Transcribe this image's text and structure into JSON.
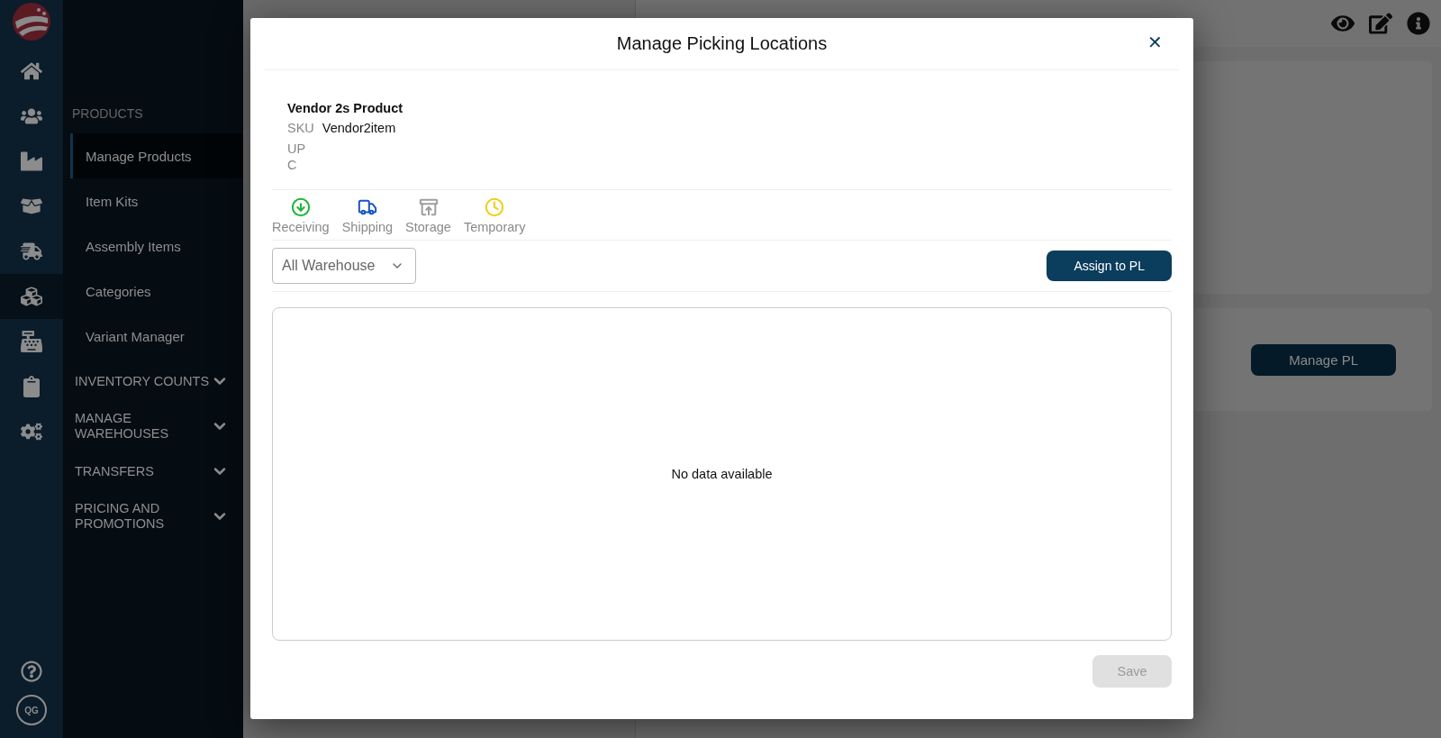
{
  "rail": {
    "items": [
      {
        "kind": "home",
        "selected": false
      },
      {
        "kind": "users",
        "selected": false
      },
      {
        "kind": "factory",
        "selected": false
      },
      {
        "kind": "box",
        "selected": false
      },
      {
        "kind": "truck",
        "selected": false
      },
      {
        "kind": "boxes",
        "selected": true
      },
      {
        "kind": "register",
        "selected": false
      },
      {
        "kind": "clipboard",
        "selected": false
      },
      {
        "kind": "gears",
        "selected": false
      }
    ],
    "avatar": "QG"
  },
  "sidebar": {
    "section": "PRODUCTS",
    "items": [
      {
        "label": "Manage Products",
        "selected": true
      },
      {
        "label": "Item Kits",
        "selected": false
      },
      {
        "label": "Assembly Items",
        "selected": false
      },
      {
        "label": "Categories",
        "selected": false
      },
      {
        "label": "Variant Manager",
        "selected": false
      }
    ],
    "groups": [
      {
        "label": "INVENTORY COUNTS",
        "expanded": false
      },
      {
        "label": "MANAGE WAREHOUSES",
        "expanded": false
      },
      {
        "label": "TRANSFERS",
        "expanded": false
      },
      {
        "label": "PRICING AND PROMOTIONS",
        "expanded": false
      }
    ]
  },
  "background": {
    "manage_pl_button": "Manage PL"
  },
  "modal": {
    "title": "Manage Picking Locations",
    "close": "✕",
    "product": {
      "name": "Vendor 2s Product",
      "sku_label": "SKU",
      "sku": "Vendor2item",
      "upc_label": "UPC"
    },
    "legend": [
      {
        "kind": "receiving",
        "label": "Receiving",
        "color": "#1db53a"
      },
      {
        "kind": "shipping",
        "label": "Shipping",
        "color": "#1a56c4"
      },
      {
        "kind": "storage",
        "label": "Storage",
        "color": "#9e9e9e"
      },
      {
        "kind": "temporary",
        "label": "Temporary",
        "color": "#f2cd14"
      }
    ],
    "warehouse_select": {
      "value": "All Warehouse"
    },
    "assign_button": "Assign to PL",
    "empty_text": "No data available",
    "save_button": {
      "label": "Save",
      "disabled": true
    }
  }
}
